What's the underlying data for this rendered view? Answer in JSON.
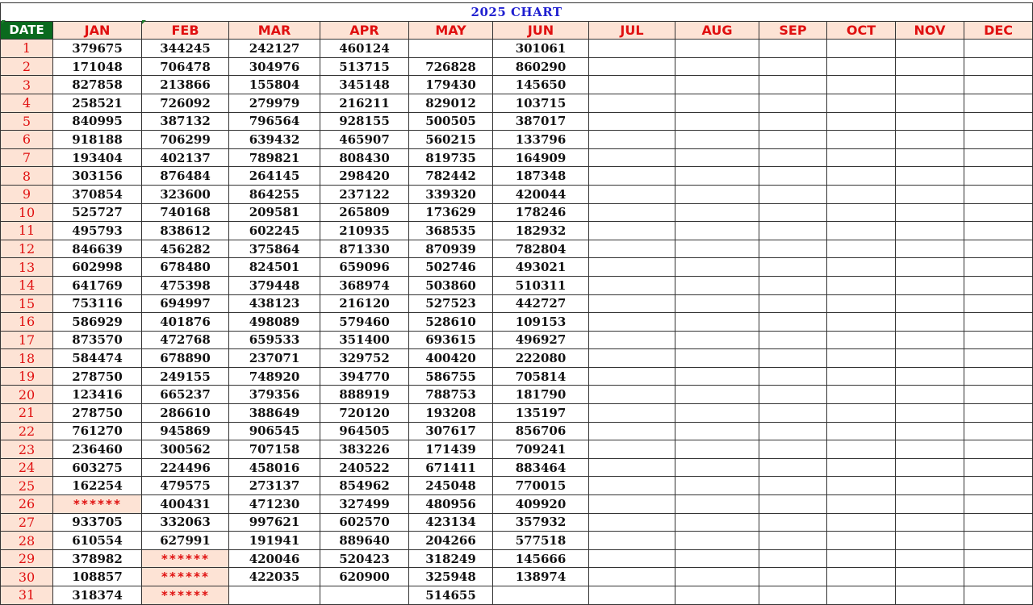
{
  "title": "2025 CHART",
  "header": {
    "date_label": "DATE",
    "months": [
      "JAN",
      "FEB",
      "MAR",
      "APR",
      "MAY",
      "JUN",
      "JUL",
      "AUG",
      "SEP",
      "OCT",
      "NOV",
      "DEC"
    ]
  },
  "rows": [
    {
      "date": "1",
      "values": [
        "379675",
        "344245",
        "242127",
        "460124",
        "",
        "301061",
        "",
        "",
        "",
        "",
        "",
        ""
      ]
    },
    {
      "date": "2",
      "values": [
        "171048",
        "706478",
        "304976",
        "513715",
        "726828",
        "860290",
        "",
        "",
        "",
        "",
        "",
        ""
      ]
    },
    {
      "date": "3",
      "values": [
        "827858",
        "213866",
        "155804",
        "345148",
        "179430",
        "145650",
        "",
        "",
        "",
        "",
        "",
        ""
      ]
    },
    {
      "date": "4",
      "values": [
        "258521",
        "726092",
        "279979",
        "216211",
        "829012",
        "103715",
        "",
        "",
        "",
        "",
        "",
        ""
      ]
    },
    {
      "date": "5",
      "values": [
        "840995",
        "387132",
        "796564",
        "928155",
        "500505",
        "387017",
        "",
        "",
        "",
        "",
        "",
        ""
      ]
    },
    {
      "date": "6",
      "values": [
        "918188",
        "706299",
        "639432",
        "465907",
        "560215",
        "133796",
        "",
        "",
        "",
        "",
        "",
        ""
      ]
    },
    {
      "date": "7",
      "values": [
        "193404",
        "402137",
        "789821",
        "808430",
        "819735",
        "164909",
        "",
        "",
        "",
        "",
        "",
        ""
      ]
    },
    {
      "date": "8",
      "values": [
        "303156",
        "876484",
        "264145",
        "298420",
        "782442",
        "187348",
        "",
        "",
        "",
        "",
        "",
        ""
      ]
    },
    {
      "date": "9",
      "values": [
        "370854",
        "323600",
        "864255",
        "237122",
        "339320",
        "420044",
        "",
        "",
        "",
        "",
        "",
        ""
      ]
    },
    {
      "date": "10",
      "values": [
        "525727",
        "740168",
        "209581",
        "265809",
        "173629",
        "178246",
        "",
        "",
        "",
        "",
        "",
        ""
      ]
    },
    {
      "date": "11",
      "values": [
        "495793",
        "838612",
        "602245",
        "210935",
        "368535",
        "182932",
        "",
        "",
        "",
        "",
        "",
        ""
      ]
    },
    {
      "date": "12",
      "values": [
        "846639",
        "456282",
        "375864",
        "871330",
        "870939",
        "782804",
        "",
        "",
        "",
        "",
        "",
        ""
      ]
    },
    {
      "date": "13",
      "values": [
        "602998",
        "678480",
        "824501",
        "659096",
        "502746",
        "493021",
        "",
        "",
        "",
        "",
        "",
        ""
      ]
    },
    {
      "date": "14",
      "values": [
        "641769",
        "475398",
        "379448",
        "368974",
        "503860",
        "510311",
        "",
        "",
        "",
        "",
        "",
        ""
      ]
    },
    {
      "date": "15",
      "values": [
        "753116",
        "694997",
        "438123",
        "216120",
        "527523",
        "442727",
        "",
        "",
        "",
        "",
        "",
        ""
      ]
    },
    {
      "date": "16",
      "values": [
        "586929",
        "401876",
        "498089",
        "579460",
        "528610",
        "109153",
        "",
        "",
        "",
        "",
        "",
        ""
      ]
    },
    {
      "date": "17",
      "values": [
        "873570",
        "472768",
        "659533",
        "351400",
        "693615",
        "496927",
        "",
        "",
        "",
        "",
        "",
        ""
      ]
    },
    {
      "date": "18",
      "values": [
        "584474",
        "678890",
        "237071",
        "329752",
        "400420",
        "222080",
        "",
        "",
        "",
        "",
        "",
        ""
      ]
    },
    {
      "date": "19",
      "values": [
        "278750",
        "249155",
        "748920",
        "394770",
        "586755",
        "705814",
        "",
        "",
        "",
        "",
        "",
        ""
      ]
    },
    {
      "date": "20",
      "values": [
        "123416",
        "665237",
        "379356",
        "888919",
        "788753",
        "181790",
        "",
        "",
        "",
        "",
        "",
        ""
      ]
    },
    {
      "date": "21",
      "values": [
        "278750",
        "286610",
        "388649",
        "720120",
        "193208",
        "135197",
        "",
        "",
        "",
        "",
        "",
        ""
      ]
    },
    {
      "date": "22",
      "values": [
        "761270",
        "945869",
        "906545",
        "964505",
        "307617",
        "856706",
        "",
        "",
        "",
        "",
        "",
        ""
      ]
    },
    {
      "date": "23",
      "values": [
        "236460",
        "300562",
        "707158",
        "383226",
        "171439",
        "709241",
        "",
        "",
        "",
        "",
        "",
        ""
      ]
    },
    {
      "date": "24",
      "values": [
        "603275",
        "224496",
        "458016",
        "240522",
        "671411",
        "883464",
        "",
        "",
        "",
        "",
        "",
        ""
      ]
    },
    {
      "date": "25",
      "values": [
        "162254",
        "479575",
        "273137",
        "854962",
        "245048",
        "770015",
        "",
        "",
        "",
        "",
        "",
        ""
      ]
    },
    {
      "date": "26",
      "values": [
        "******",
        "400431",
        "471230",
        "327499",
        "480956",
        "409920",
        "",
        "",
        "",
        "",
        "",
        ""
      ]
    },
    {
      "date": "27",
      "values": [
        "933705",
        "332063",
        "997621",
        "602570",
        "423134",
        "357932",
        "",
        "",
        "",
        "",
        "",
        ""
      ]
    },
    {
      "date": "28",
      "values": [
        "610554",
        "627991",
        "191941",
        "889640",
        "204266",
        "577518",
        "",
        "",
        "",
        "",
        "",
        ""
      ]
    },
    {
      "date": "29",
      "values": [
        "378982",
        "******",
        "420046",
        "520423",
        "318249",
        "145666",
        "",
        "",
        "",
        "",
        "",
        ""
      ]
    },
    {
      "date": "30",
      "values": [
        "108857",
        "******",
        "422035",
        "620900",
        "325948",
        "138974",
        "",
        "",
        "",
        "",
        "",
        ""
      ]
    },
    {
      "date": "31",
      "values": [
        "318374",
        "******",
        "",
        "",
        "514655",
        "",
        "",
        "",
        "",
        "",
        "",
        ""
      ]
    }
  ],
  "colors": {
    "date_header_bg": "#0a6a1e",
    "header_bg": "#fde3d5",
    "header_text": "#e01010",
    "title_text": "#1f1fd0",
    "mask_text": "#e01010"
  }
}
